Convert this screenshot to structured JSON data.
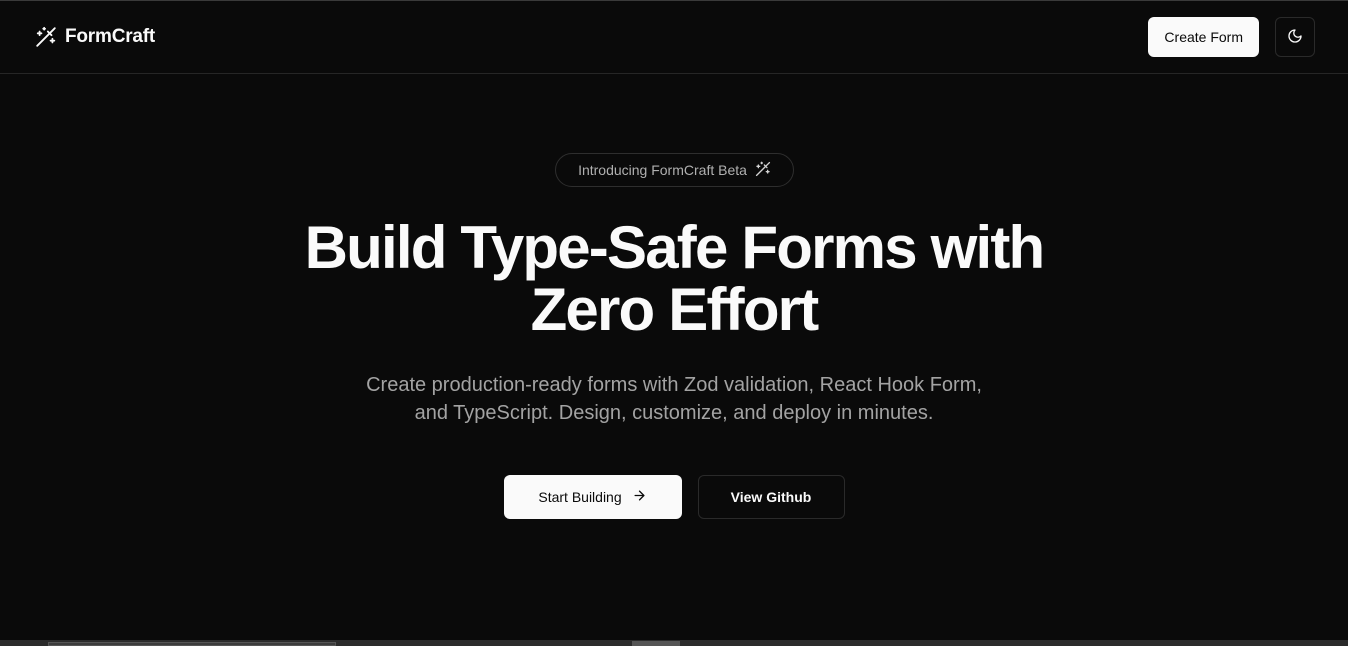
{
  "header": {
    "brand_name": "FormCraft",
    "brand_icon": "wand-sparkles-icon",
    "create_label": "Create Form",
    "theme_icon": "moon-icon"
  },
  "hero": {
    "badge_text": "Introducing FormCraft Beta",
    "badge_icon": "wand-sparkles-icon",
    "title_line1": "Build Type-Safe Forms with",
    "title_line2": "Zero Effort",
    "subtitle_line1": "Create production-ready forms with Zod validation, React Hook Form,",
    "subtitle_line2": "and TypeScript. Design, customize, and deploy in minutes.",
    "primary_label": "Start Building",
    "primary_icon": "arrow-right-icon",
    "secondary_label": "View Github"
  },
  "colors": {
    "background": "#0a0a0a",
    "foreground": "#fafafa",
    "muted": "#a3a3a3",
    "border": "#262626"
  }
}
